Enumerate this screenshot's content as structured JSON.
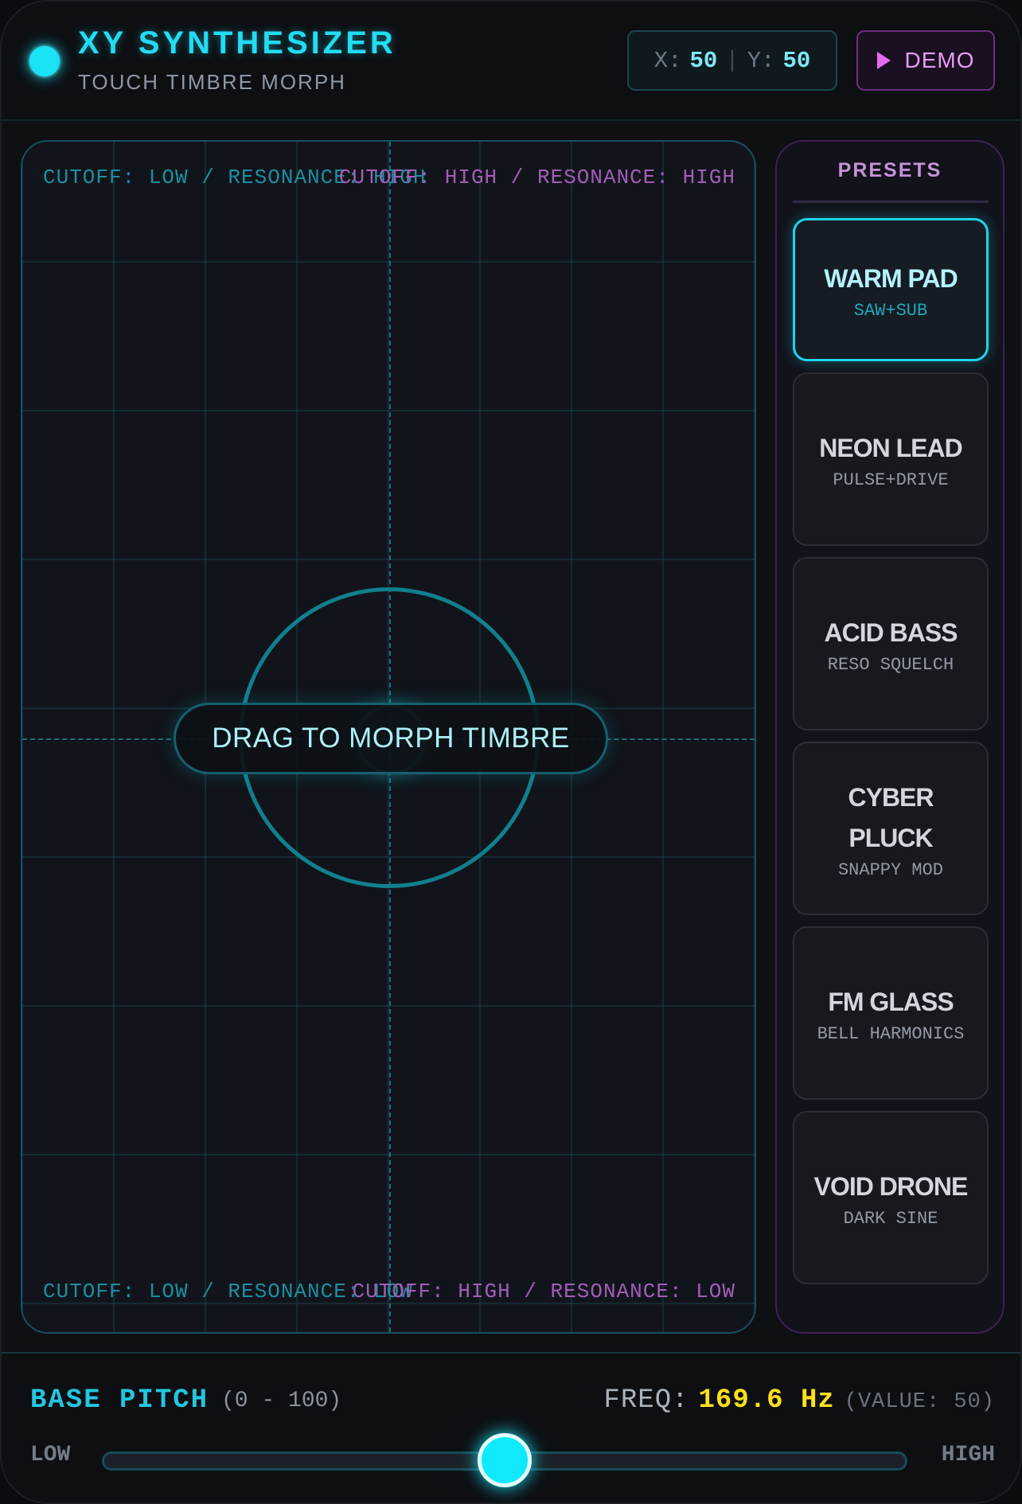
{
  "header": {
    "title": "XY SYNTHESIZER",
    "subtitle": "TOUCH TIMBRE MORPH",
    "coords": {
      "x_label": "X:",
      "x_value": "50",
      "separator": "|",
      "y_label": "Y:",
      "y_value": "50"
    },
    "demo_label": "DEMO",
    "demo_icon": "play-icon"
  },
  "pad": {
    "corner_top_left": "CUTOFF: LOW / RESONANCE: HIGH",
    "corner_top_right": "CUTOFF: HIGH / RESONANCE: HIGH",
    "corner_bottom_left": "CUTOFF: LOW / RESONANCE: LOW",
    "corner_bottom_right": "CUTOFF: HIGH / RESONANCE: LOW",
    "hint": "DRAG TO MORPH TIMBRE"
  },
  "presets": {
    "title": "PRESETS",
    "items": [
      {
        "name": "WARM PAD",
        "desc": "SAW+SUB",
        "active": true
      },
      {
        "name": "NEON LEAD",
        "desc": "PULSE+DRIVE",
        "active": false
      },
      {
        "name": "ACID BASS",
        "desc": "RESO SQUELCH",
        "active": false
      },
      {
        "name": "CYBER PLUCK",
        "desc": "SNAPPY MOD",
        "active": false
      },
      {
        "name": "FM GLASS",
        "desc": "BELL HARMONICS",
        "active": false
      },
      {
        "name": "VOID DRONE",
        "desc": "DARK SINE",
        "active": false
      }
    ]
  },
  "pitch": {
    "label": "BASE PITCH",
    "range": "(0 - 100)",
    "freq_label": "FREQ:",
    "freq_value": "169.6 Hz",
    "raw_value": "(VALUE: 50)",
    "low": "LOW",
    "high": "HIGH",
    "slider_level": 0.5
  },
  "colors": {
    "accent_cyan": "#19e3f5",
    "accent_magenta": "#e46bf0",
    "freq_yellow": "#ffe01a"
  }
}
